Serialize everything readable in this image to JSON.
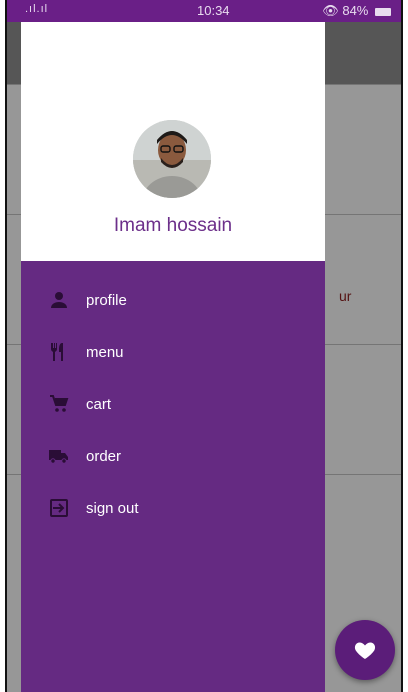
{
  "status_bar": {
    "time": "10:34",
    "battery": "84%",
    "signal_text": ".ıl.ıl"
  },
  "profile": {
    "name": "Imam hossain"
  },
  "menu": [
    {
      "label": "profile",
      "icon": "person-icon"
    },
    {
      "label": "menu",
      "icon": "restaurant-icon"
    },
    {
      "label": "cart",
      "icon": "cart-icon"
    },
    {
      "label": "order",
      "icon": "truck-icon"
    },
    {
      "label": "sign out",
      "icon": "sign-out-icon"
    }
  ],
  "background": {
    "partial_text": "ur"
  },
  "colors": {
    "drawer": "#652a82",
    "accent": "#6c2f8a",
    "status_bar": "#6a1f87"
  }
}
